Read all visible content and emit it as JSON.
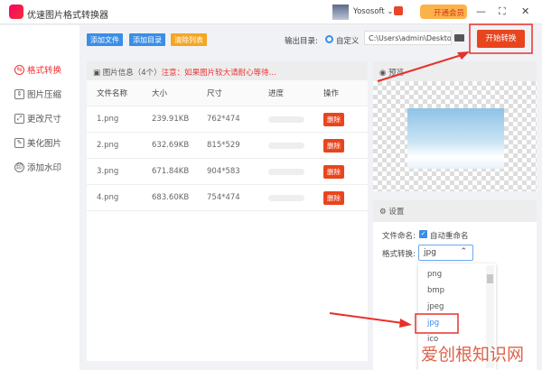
{
  "app": {
    "title": "优速图片格式转换器",
    "user": "Yososoft",
    "vip_label": "开通会员"
  },
  "sidebar": {
    "items": [
      {
        "label": "格式转换",
        "active": true
      },
      {
        "label": "图片压缩"
      },
      {
        "label": "更改尺寸"
      },
      {
        "label": "美化图片"
      },
      {
        "label": "添加水印"
      }
    ]
  },
  "toolbar": {
    "add_file": "添加文件",
    "add_dir": "添加目录",
    "clear": "清除列表",
    "output_label": "输出目录:",
    "radio_label": "自定义",
    "output_path": "C:\\Users\\admin\\Deskto",
    "start": "开始转换"
  },
  "list": {
    "header": "图片信息（4个）",
    "notice": "注意：如果图片较大请耐心等待...",
    "columns": [
      "文件名称",
      "大小",
      "尺寸",
      "进度",
      "操作"
    ],
    "rows": [
      {
        "name": "1.png",
        "size": "239.91KB",
        "dim": "762*474",
        "progress": 0
      },
      {
        "name": "2.png",
        "size": "632.69KB",
        "dim": "815*529",
        "progress": 0
      },
      {
        "name": "3.png",
        "size": "671.84KB",
        "dim": "904*583",
        "progress": 0
      },
      {
        "name": "4.png",
        "size": "683.60KB",
        "dim": "754*474",
        "progress": 0
      }
    ],
    "delete_label": "删除"
  },
  "preview": {
    "title": "预览"
  },
  "settings": {
    "title": "设置",
    "naming_label": "文件命名:",
    "auto_rename": "自动重命名",
    "auto_rename_checked": true,
    "format_label": "格式转换:",
    "format_value": "jpg",
    "options": [
      "png",
      "bmp",
      "jpeg",
      "jpg",
      "ico"
    ]
  },
  "watermark": "爱创根知识网",
  "colors": {
    "accent": "#e8451f",
    "blue": "#3a8ee6",
    "orange": "#f5a623",
    "annotation": "#e8302a"
  }
}
